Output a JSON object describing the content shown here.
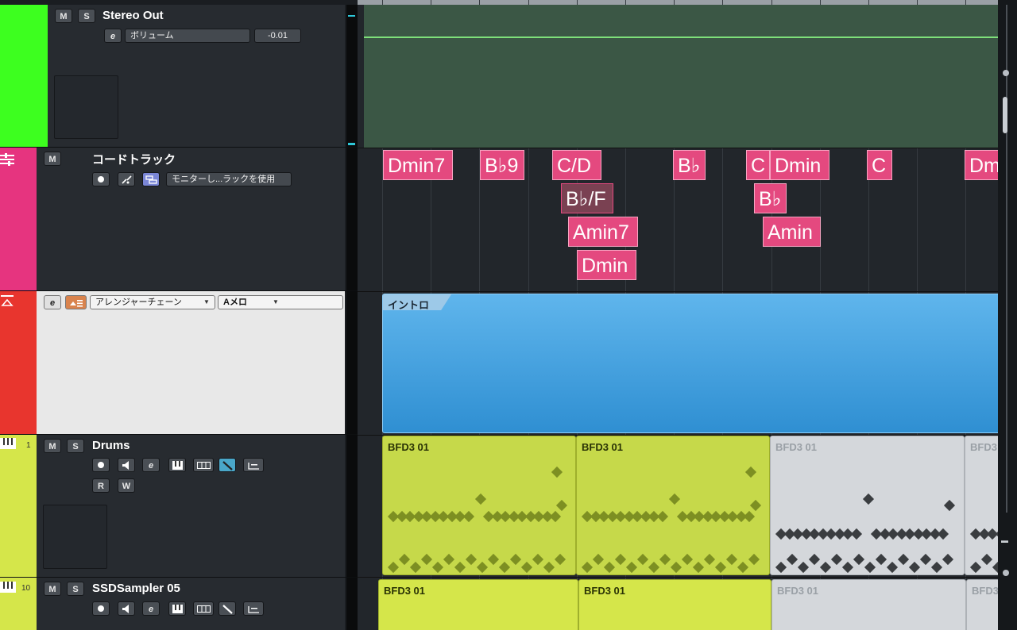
{
  "colors": {
    "stereo_out": "#3dff1f",
    "chord_track": "#e6347f",
    "arranger": "#e8352e",
    "drums": "#d5e64a",
    "sampler": "#d5e64a",
    "chord_event": "#e4497f",
    "arranger_part": "#3e9fdd",
    "midi_part": "#c6d94a",
    "muted_part": "#d4d7db"
  },
  "tracks": {
    "stereo_out": {
      "name": "Stereo Out",
      "m": "M",
      "s": "S",
      "e": "e",
      "param_label": "ボリューム",
      "param_value": "-0.01"
    },
    "chord": {
      "name": "コードトラック",
      "m": "M",
      "monitor_label": "モニターし...ラックを使用"
    },
    "arranger": {
      "e": "e",
      "chain_select": "アレンジャーチェーン",
      "part_select": "Aメロ"
    },
    "drums": {
      "number": "1",
      "name": "Drums",
      "m": "M",
      "s": "S",
      "e": "e",
      "r": "R",
      "w": "W"
    },
    "sampler": {
      "number": "10",
      "name": "SSDSampler 05",
      "m": "M",
      "s": "S",
      "e": "e"
    }
  },
  "chords": [
    {
      "label": "Dmin7"
    },
    {
      "label": "B♭9"
    },
    {
      "label": "C/D"
    },
    {
      "label": "B♭/F"
    },
    {
      "label": "Amin7"
    },
    {
      "label": "Dmin"
    },
    {
      "label": "B♭"
    },
    {
      "label": "C"
    },
    {
      "label": "Dmin"
    },
    {
      "label": "B♭"
    },
    {
      "label": "Amin"
    },
    {
      "label": "C"
    },
    {
      "label": "Dm"
    }
  ],
  "arranger_part": {
    "label": "イントロ"
  },
  "drum_parts": [
    {
      "label": "BFD3 01"
    },
    {
      "label": "BFD3 01"
    },
    {
      "label": "BFD3 01"
    },
    {
      "label": "BFD3"
    }
  ],
  "sampler_parts": [
    {
      "label": "BFD3 01"
    },
    {
      "label": "BFD3 01"
    },
    {
      "label": "BFD3 01"
    },
    {
      "label": "BFD3"
    }
  ]
}
